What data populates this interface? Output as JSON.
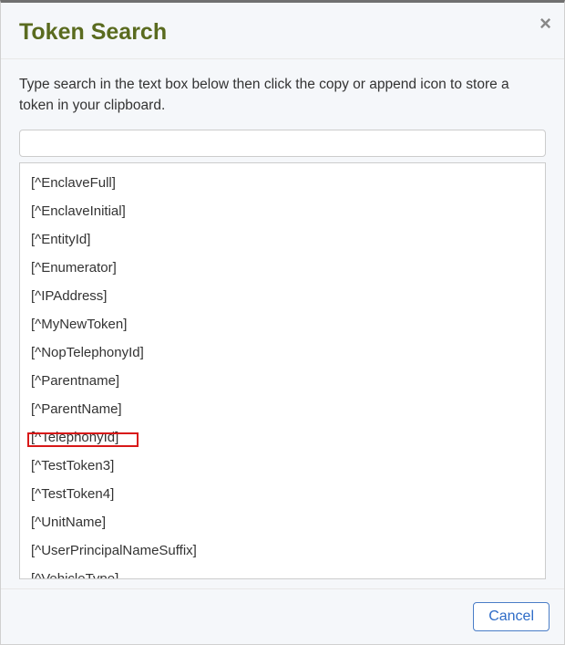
{
  "modal": {
    "title": "Token Search",
    "close_label": "×",
    "instructions": "Type search in the text box below then click the copy or append icon to store a token in your clipboard.",
    "search_value": "",
    "search_placeholder": "",
    "tokens": [
      "[^EnclaveFull]",
      "[^EnclaveInitial]",
      "[^EntityId]",
      "[^Enumerator]",
      "[^IPAddress]",
      "[^MyNewToken]",
      "[^NopTelephonyId]",
      "[^Parentname]",
      "[^ParentName]",
      "[^TelephonyId]",
      "[^TestToken3]",
      "[^TestToken4]",
      "[^UnitName]",
      "[^UserPrincipalNameSuffix]",
      "[^VehicleType]"
    ],
    "cancel_label": "Cancel"
  }
}
